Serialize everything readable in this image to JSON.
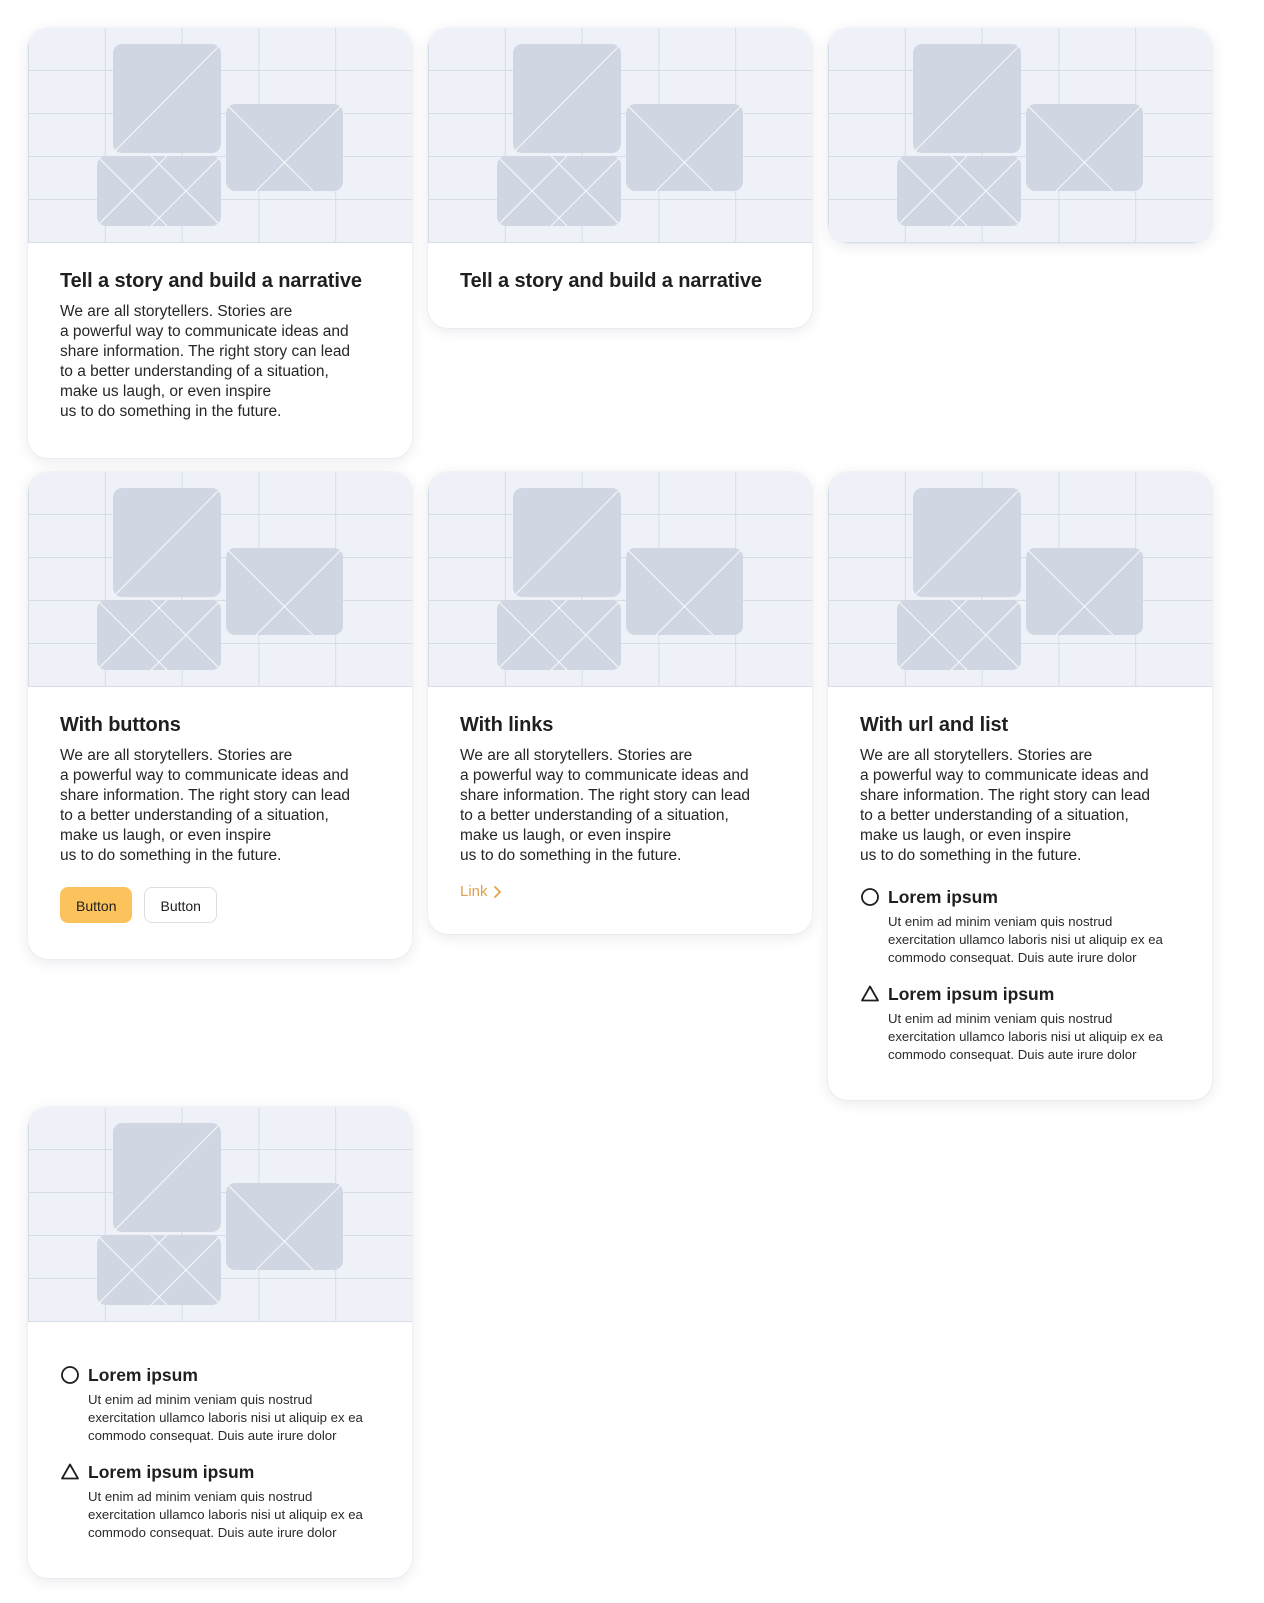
{
  "cards": {
    "card1": {
      "title": "Tell a story and build a narrative",
      "lines": [
        "We are all storytellers. Stories are",
        "a powerful way to communicate ideas and",
        "share information. The right story can lead",
        "to a better understanding of a situation,",
        "make us laugh, or even inspire",
        "us to do something in the future."
      ]
    },
    "card2": {
      "title": "Tell a story and build a narrative"
    },
    "card4": {
      "title": "With buttons",
      "lines": [
        "We are all storytellers. Stories are",
        "a powerful way to communicate ideas and",
        "share information. The right story can lead",
        "to a better understanding of a situation,",
        "make us laugh, or even inspire",
        "us to do something in the future."
      ],
      "primary_button": "Button",
      "secondary_button": "Button"
    },
    "card5": {
      "title": "With links",
      "lines": [
        "We are all storytellers. Stories are",
        "a powerful way to communicate ideas and",
        "share information. The right story can lead",
        "to a better understanding of a situation,",
        "make us laugh, or even inspire",
        "us to do something in the future."
      ],
      "link": "Link"
    },
    "card6": {
      "title": "With url and list",
      "lines": [
        "We are all storytellers. Stories are",
        "a powerful way to communicate ideas and",
        "share information. The right story can lead",
        "to a better understanding of a situation,",
        "make us laugh, or even inspire",
        "us to do something in the future."
      ],
      "items": [
        {
          "icon": "circle-icon",
          "title": "Lorem ipsum",
          "desc": [
            "Ut enim ad minim veniam quis nostrud",
            "exercitation ullamco laboris nisi ut aliquip ex ea",
            "commodo consequat. Duis aute irure dolor"
          ]
        },
        {
          "icon": "triangle-icon",
          "title": "Lorem ipsum ipsum",
          "desc": [
            "Ut enim ad minim veniam quis nostrud",
            "exercitation ullamco laboris nisi ut aliquip ex ea",
            "commodo consequat. Duis aute irure dolor"
          ]
        }
      ]
    },
    "card7": {
      "items": [
        {
          "icon": "circle-icon",
          "title": "Lorem ipsum",
          "desc": [
            "Ut enim ad minim veniam quis nostrud",
            "exercitation ullamco laboris nisi ut aliquip ex ea",
            "commodo consequat. Duis aute irure dolor"
          ]
        },
        {
          "icon": "triangle-icon",
          "title": "Lorem ipsum ipsum",
          "desc": [
            "Ut enim ad minim veniam quis nostrud",
            "exercitation ullamco laboris nisi ut aliquip ex ea",
            "commodo consequat. Duis aute irure dolor"
          ]
        }
      ]
    }
  },
  "colors": {
    "accent": "#fcc25c",
    "link": "#e0a24c",
    "image_bg": "#eef1f8",
    "placeholder_block": "#d0d7e3"
  },
  "icons": {
    "image": "image-placeholder-icon",
    "list_first": "circle-icon",
    "list_second": "triangle-icon",
    "link_arrow": "chevron-right-icon"
  }
}
